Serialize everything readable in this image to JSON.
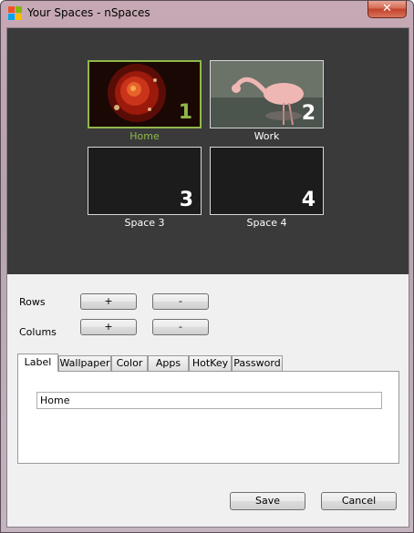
{
  "window": {
    "title": "Your Spaces - nSpaces",
    "close_label": "✕"
  },
  "spaces": [
    {
      "number": "1",
      "name": "Home"
    },
    {
      "number": "2",
      "name": "Work"
    },
    {
      "number": "3",
      "name": "Space 3"
    },
    {
      "number": "4",
      "name": "Space 4"
    }
  ],
  "grid_controls": {
    "rows_label": "Rows",
    "columns_label": "Colums",
    "plus_label": "+",
    "minus_label": "-"
  },
  "tabs": [
    {
      "label": "Label"
    },
    {
      "label": "Wallpaper"
    },
    {
      "label": "Color"
    },
    {
      "label": "Apps"
    },
    {
      "label": "HotKey"
    },
    {
      "label": "Password"
    }
  ],
  "label_tab": {
    "value": "Home"
  },
  "footer": {
    "save_label": "Save",
    "cancel_label": "Cancel"
  },
  "colors": {
    "accent": "#8fb84a",
    "panel": "#3a3a3a"
  }
}
